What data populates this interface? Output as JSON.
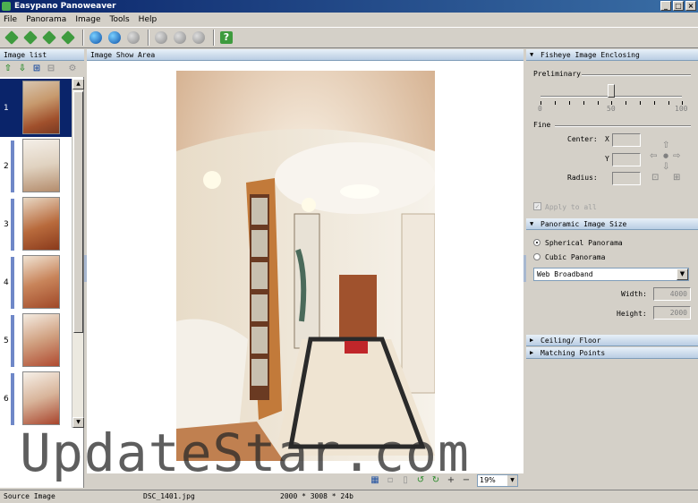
{
  "window": {
    "title": "Easypano Panoweaver",
    "min": "_",
    "max": "□",
    "close": "×"
  },
  "menu": [
    "File",
    "Panorama",
    "Image",
    "Tools",
    "Help"
  ],
  "image_list": {
    "header": "Image list",
    "thumbs": [
      {
        "num": "1"
      },
      {
        "num": "2"
      },
      {
        "num": "3"
      },
      {
        "num": "4"
      },
      {
        "num": "5"
      },
      {
        "num": "6"
      }
    ]
  },
  "show_area": {
    "header": "Image Show Area",
    "zoom": "19%"
  },
  "fisheye": {
    "header": "Fisheye Image Enclosing",
    "preliminary": "Preliminary",
    "slider": {
      "min": "0",
      "mid": "50",
      "max": "100",
      "value": 50
    },
    "fine": "Fine",
    "center": "Center:",
    "x": "X",
    "y": "Y",
    "radius": "Radius:",
    "apply": "Apply to all"
  },
  "pano_size": {
    "header": "Panoramic Image Size",
    "spherical": "Spherical Panorama",
    "cubic": "Cubic Panorama",
    "preset": "Web Broadband",
    "width_label": "Width:",
    "width": "4000",
    "height_label": "Height:",
    "height": "2000"
  },
  "collapsed": {
    "ceiling": "Ceiling/ Floor",
    "matching": "Matching Points"
  },
  "status": {
    "source": "Source Image",
    "file": "DSC_1401.jpg",
    "dims": "2000 * 3008 * 24b"
  },
  "watermark": "UpdateStar.com"
}
